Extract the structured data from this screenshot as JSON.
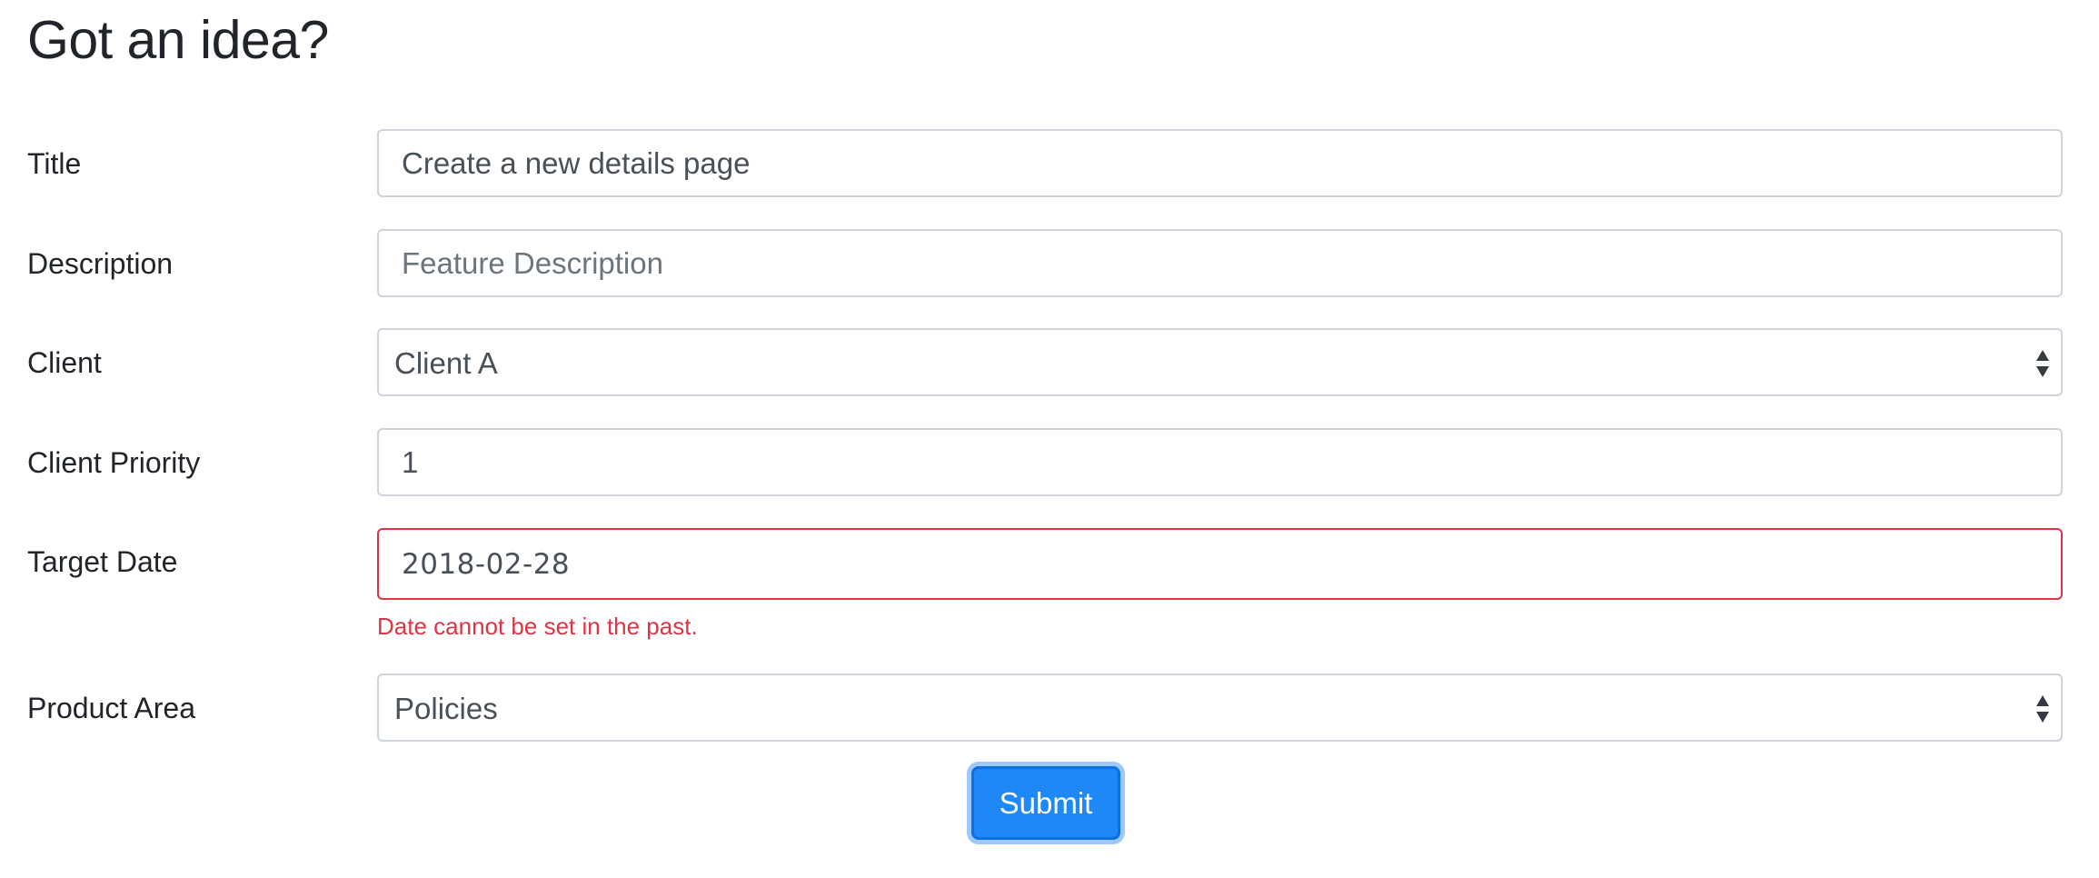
{
  "page": {
    "title": "Got an idea?"
  },
  "form": {
    "title": {
      "label": "Title",
      "value": "Create a new details page",
      "placeholder": ""
    },
    "description": {
      "label": "Description",
      "value": "",
      "placeholder": "Feature Description"
    },
    "client": {
      "label": "Client",
      "selected": "Client A"
    },
    "client_priority": {
      "label": "Client Priority",
      "value": "1"
    },
    "target_date": {
      "label": "Target Date",
      "value": "2018-02-28",
      "error": "Date cannot be set in the past."
    },
    "product_area": {
      "label": "Product Area",
      "selected": "Policies"
    },
    "submit_label": "Submit"
  },
  "colors": {
    "primary": "#1e88f7",
    "danger": "#dc3545",
    "border": "#ced4da",
    "text": "#212529"
  },
  "icons": {
    "select_arrows": "select-arrows-icon"
  }
}
